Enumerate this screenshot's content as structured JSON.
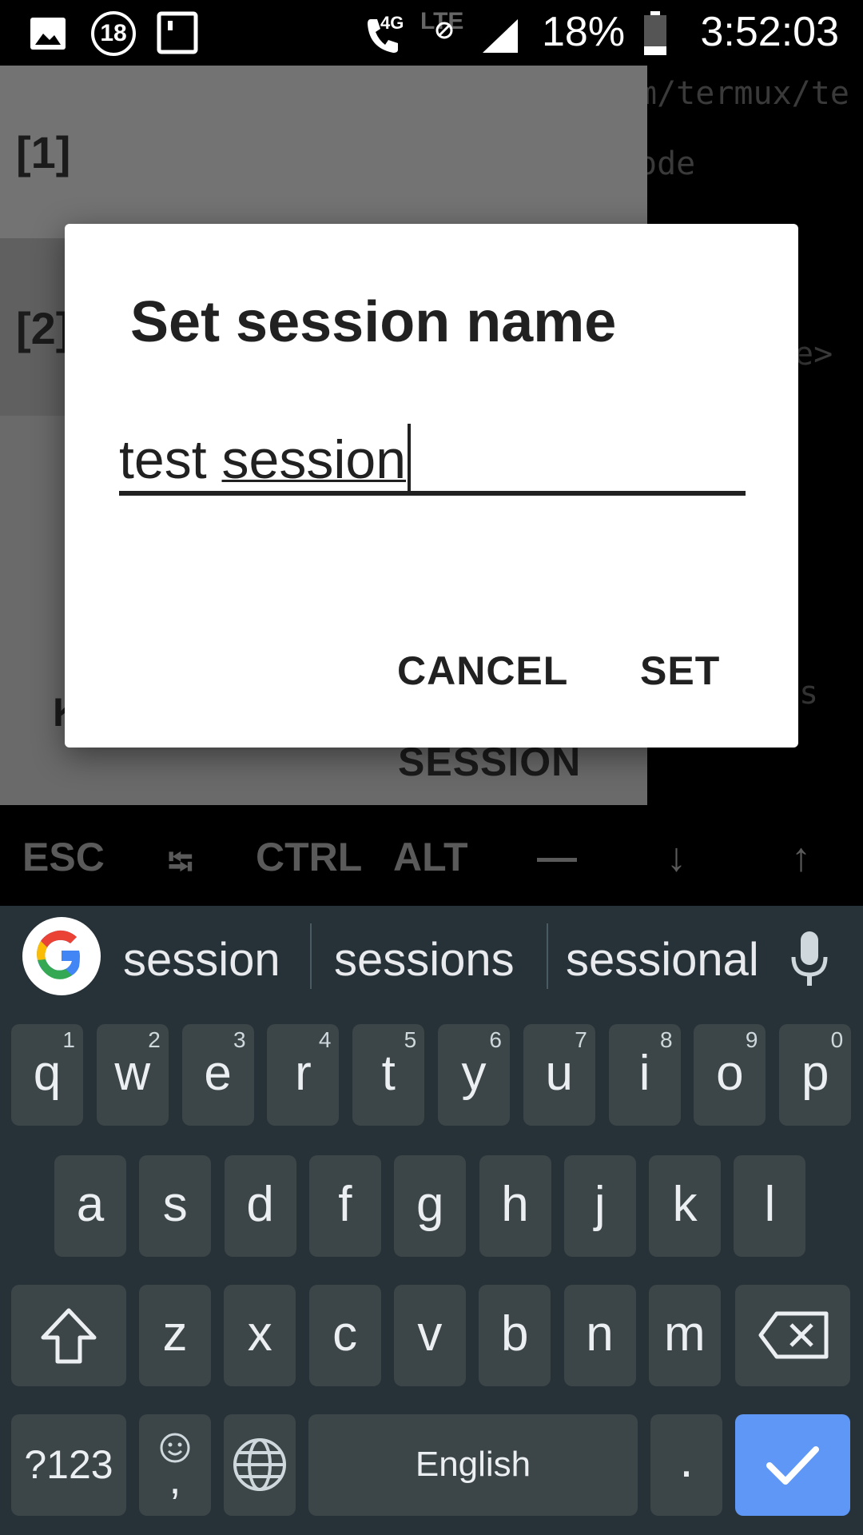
{
  "status_bar": {
    "network_type": "4G",
    "network_lte": "LTE",
    "badge_number": "18",
    "battery_percent": "18%",
    "time": "3:52:03"
  },
  "terminal": {
    "lines": [
      "m/termux/te",
      "ode",
      "e>",
      "s"
    ]
  },
  "drawer": {
    "sessions": [
      "[1]",
      "[2]"
    ],
    "left_button_partial": "K",
    "new_session_partial": "SESSION"
  },
  "dialog": {
    "title": "Set session name",
    "input_prefix": "test ",
    "input_composing": "session",
    "cancel_label": "CANCEL",
    "set_label": "SET"
  },
  "extra_keys": [
    "ESC",
    "⭾",
    "CTRL",
    "ALT",
    "—",
    "↓",
    "↑"
  ],
  "keyboard": {
    "suggestions": [
      "session",
      "sessions",
      "sessional"
    ],
    "row1": [
      {
        "key": "q",
        "hint": "1"
      },
      {
        "key": "w",
        "hint": "2"
      },
      {
        "key": "e",
        "hint": "3"
      },
      {
        "key": "r",
        "hint": "4"
      },
      {
        "key": "t",
        "hint": "5"
      },
      {
        "key": "y",
        "hint": "6"
      },
      {
        "key": "u",
        "hint": "7"
      },
      {
        "key": "i",
        "hint": "8"
      },
      {
        "key": "o",
        "hint": "9"
      },
      {
        "key": "p",
        "hint": "0"
      }
    ],
    "row2": [
      "a",
      "s",
      "d",
      "f",
      "g",
      "h",
      "j",
      "k",
      "l"
    ],
    "row3": [
      "z",
      "x",
      "c",
      "v",
      "b",
      "n",
      "m"
    ],
    "symbols_label": "?123",
    "comma_label": ",",
    "space_label": "English",
    "period_label": ".",
    "enter_color": "#5e97f6"
  },
  "colors": {
    "keyboard_bg": "#263238",
    "key_bg": "#3c4548",
    "drawer_bg": "#6a6a6a"
  }
}
